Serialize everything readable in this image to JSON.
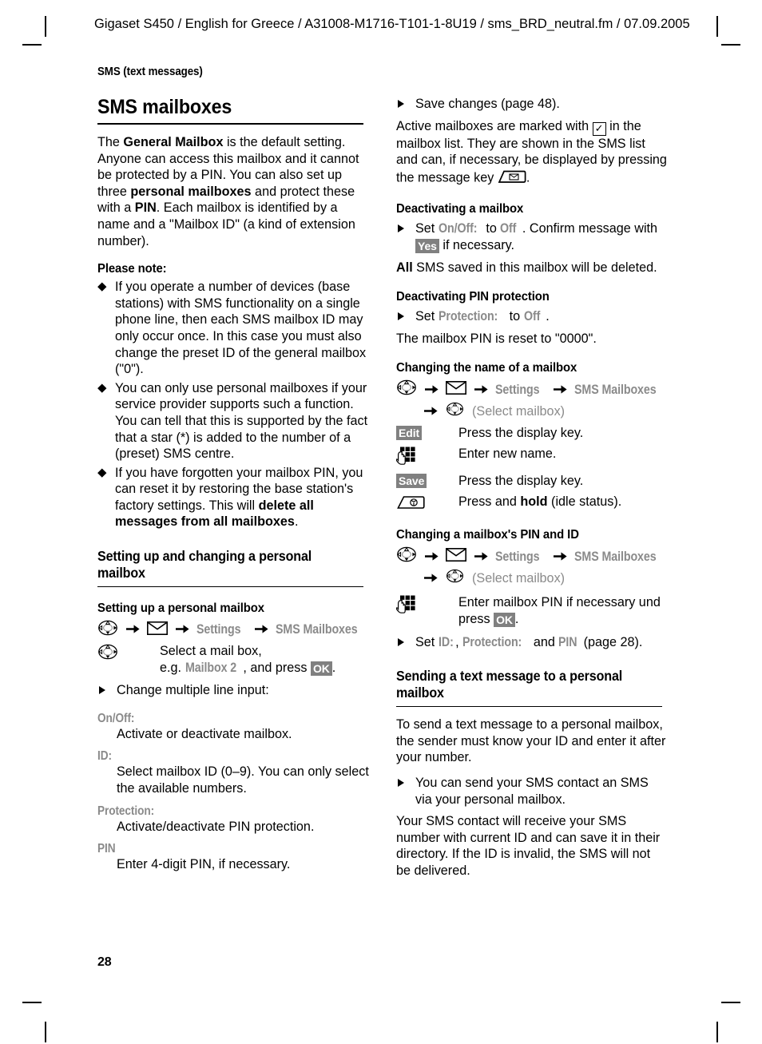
{
  "header": {
    "running_head": "Gigaset S450 / English for Greece / A31008-M1716-T101-1-8U19 / sms_BRD_neutral.fm / 07.09.2005",
    "chapter_marker": "SMS (text messages)"
  },
  "folio": {
    "page_number": "28"
  },
  "colors": {
    "text": "#000000",
    "ui_term_gray": "#8a8a8a",
    "softkey_bg": "#808080",
    "softkey_fg": "#ffffff"
  },
  "left_column": {
    "title": "SMS mailboxes",
    "intro": {
      "p1_a": "The ",
      "p1_b": "General Mailbox",
      "p1_c": " is the default setting. Anyone can access this mailbox and it cannot be protected by a PIN. You can also set up three ",
      "p1_d": "personal mailboxes",
      "p1_e": " and protect these with a ",
      "p1_f": "PIN",
      "p1_g": ". Each mailbox is identified by a name and a \"Mailbox ID\" (a kind of extension number)."
    },
    "please_note_heading": "Please note:",
    "notes": [
      "If you operate a number of devices (base stations) with SMS functionality on a single phone line, then each SMS mailbox ID may only occur once. In this case you must also change the preset ID of the general mailbox (\"0\").",
      "You can only use personal mailboxes if your service provider supports such a function. You can tell that this is supported by the fact that a star (*) is added to the number of a (preset) SMS centre."
    ],
    "note3": {
      "a": "If you have forgotten your mailbox PIN, you can reset it by restoring the base station's factory settings. This will ",
      "b": "delete all messages from all mailboxes",
      "c": "."
    },
    "section_heading": "Setting up and changing a personal mailbox",
    "subsection_heading": "Setting up a personal mailbox",
    "menu_path": {
      "nav_icon": "navigation-key-icon",
      "arrow": "➔",
      "envelope_icon": "envelope-icon",
      "item_settings": "Settings",
      "item_sms_mailboxes": "SMS Mailboxes"
    },
    "select_step": {
      "icon": "navigation-key-icon",
      "line1": "Select a mail box,",
      "line2_a": "e.g. ",
      "line2_ui": "Mailbox 2",
      "line2_b": ", and press ",
      "line2_key": "OK",
      "line2_c": "."
    },
    "change_step": "Change multiple line input:",
    "definitions": [
      {
        "term": "On/Off:",
        "desc": "Activate or deactivate mailbox."
      },
      {
        "term": "ID:",
        "desc": "Select mailbox ID (0–9). You can only select the available numbers."
      },
      {
        "term": "Protection:",
        "desc": "Activate/deactivate PIN protection."
      },
      {
        "term": "PIN",
        "desc": "Enter 4-digit PIN, if necessary."
      }
    ]
  },
  "right_column": {
    "save_step": "Save changes (page 48).",
    "active_mailboxes": {
      "a": "Active mailboxes are marked with ",
      "check": "✓",
      "b": " in the mailbox list. They are shown in the SMS list and can, if necessary, be displayed by pressing the message key ",
      "icon": "message-key-icon",
      "c": "."
    },
    "deactivating_mailbox": {
      "heading": "Deactivating a mailbox",
      "step_a": "Set ",
      "step_ui1": "On/Off:",
      "step_b": " to ",
      "step_ui2": "Off",
      "step_c": " . Confirm message with ",
      "step_key": "Yes",
      "step_d": " if necessary.",
      "note_a": "All",
      "note_b": " SMS saved in this mailbox will be deleted."
    },
    "deactivating_pin": {
      "heading": "Deactivating PIN protection",
      "step_a": "Set ",
      "step_ui1": "Protection:",
      "step_b": " to ",
      "step_ui2": "Off",
      "step_c": " .",
      "note": "The mailbox PIN is reset to \"0000\"."
    },
    "changing_name": {
      "heading": "Changing the name of a mailbox",
      "path": {
        "item_settings": "Settings",
        "item_sms_mailboxes": "SMS Mailboxes",
        "select_mailbox": "(Select mailbox)"
      },
      "rows": [
        {
          "key": "Edit",
          "key_type": "softkey",
          "desc": "Press the display key."
        },
        {
          "key": "keypad-icon",
          "key_type": "icon",
          "desc": "Enter new name."
        },
        {
          "key": "Save",
          "key_type": "softkey",
          "desc": "Press the display key."
        },
        {
          "key": "end-call-key-icon",
          "key_type": "icon",
          "desc_a": "Press and ",
          "desc_b": "hold",
          "desc_c": " (idle status)."
        }
      ]
    },
    "changing_pin_id": {
      "heading": "Changing a mailbox's PIN and ID",
      "path": {
        "item_settings": "Settings",
        "item_sms_mailboxes": "SMS Mailboxes",
        "select_mailbox": "(Select mailbox)"
      },
      "keypad_row": {
        "icon": "keypad-icon",
        "desc_a": "Enter mailbox PIN if necessary und press ",
        "desc_key": "OK",
        "desc_b": "."
      },
      "set_step": {
        "a": "Set ",
        "ui1": "ID:",
        "b": ", ",
        "ui2": "Protection:",
        "c": " and ",
        "ui3": "PIN",
        "d": " (page 28)."
      }
    },
    "sending_section": {
      "heading": "Sending a text message to a personal mailbox",
      "p1": "To send a text message to a personal mailbox, the sender must know your ID and enter it after your number.",
      "step": "You can send your SMS contact an SMS via your personal mailbox.",
      "p2": "Your SMS contact will receive your SMS number with current ID and can save it in their directory. If the ID is invalid, the SMS will not be delivered."
    }
  }
}
